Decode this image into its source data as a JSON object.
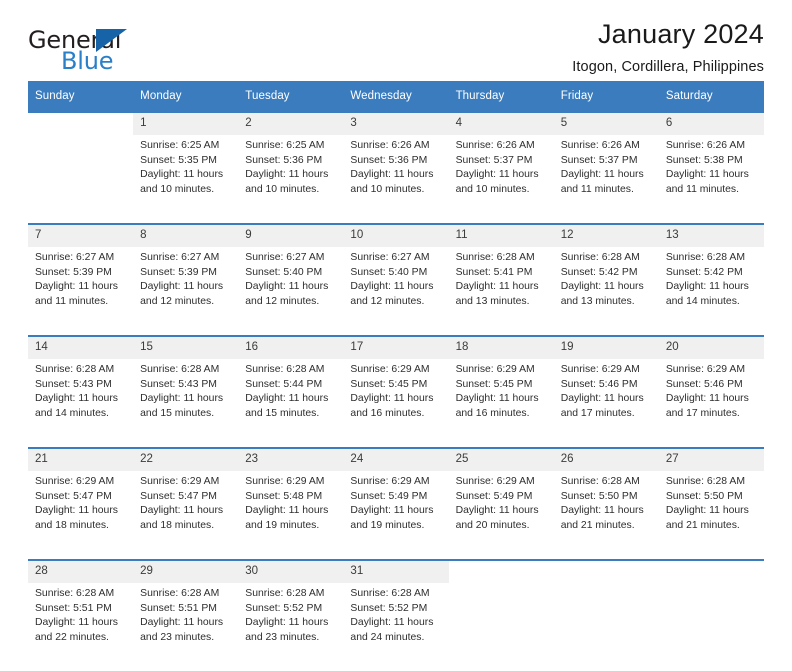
{
  "brand": {
    "name_top": "General",
    "name_bottom": "Blue",
    "accent_color": "#2a7fc9",
    "triangle_color": "#1763a8",
    "triangle_icon": "triangle-icon"
  },
  "header": {
    "title": "January 2024",
    "subtitle": "Itogon, Cordillera, Philippines"
  },
  "calendar": {
    "header_bg": "#3a7cbe",
    "daynum_bg": "#f0f0f0",
    "weekdays": [
      "Sunday",
      "Monday",
      "Tuesday",
      "Wednesday",
      "Thursday",
      "Friday",
      "Saturday"
    ],
    "weeks": [
      [
        {
          "day": "",
          "sunrise": "",
          "sunset": "",
          "daylight_1": "",
          "daylight_2": ""
        },
        {
          "day": "1",
          "sunrise": "Sunrise: 6:25 AM",
          "sunset": "Sunset: 5:35 PM",
          "daylight_1": "Daylight: 11 hours",
          "daylight_2": "and 10 minutes."
        },
        {
          "day": "2",
          "sunrise": "Sunrise: 6:25 AM",
          "sunset": "Sunset: 5:36 PM",
          "daylight_1": "Daylight: 11 hours",
          "daylight_2": "and 10 minutes."
        },
        {
          "day": "3",
          "sunrise": "Sunrise: 6:26 AM",
          "sunset": "Sunset: 5:36 PM",
          "daylight_1": "Daylight: 11 hours",
          "daylight_2": "and 10 minutes."
        },
        {
          "day": "4",
          "sunrise": "Sunrise: 6:26 AM",
          "sunset": "Sunset: 5:37 PM",
          "daylight_1": "Daylight: 11 hours",
          "daylight_2": "and 10 minutes."
        },
        {
          "day": "5",
          "sunrise": "Sunrise: 6:26 AM",
          "sunset": "Sunset: 5:37 PM",
          "daylight_1": "Daylight: 11 hours",
          "daylight_2": "and 11 minutes."
        },
        {
          "day": "6",
          "sunrise": "Sunrise: 6:26 AM",
          "sunset": "Sunset: 5:38 PM",
          "daylight_1": "Daylight: 11 hours",
          "daylight_2": "and 11 minutes."
        }
      ],
      [
        {
          "day": "7",
          "sunrise": "Sunrise: 6:27 AM",
          "sunset": "Sunset: 5:39 PM",
          "daylight_1": "Daylight: 11 hours",
          "daylight_2": "and 11 minutes."
        },
        {
          "day": "8",
          "sunrise": "Sunrise: 6:27 AM",
          "sunset": "Sunset: 5:39 PM",
          "daylight_1": "Daylight: 11 hours",
          "daylight_2": "and 12 minutes."
        },
        {
          "day": "9",
          "sunrise": "Sunrise: 6:27 AM",
          "sunset": "Sunset: 5:40 PM",
          "daylight_1": "Daylight: 11 hours",
          "daylight_2": "and 12 minutes."
        },
        {
          "day": "10",
          "sunrise": "Sunrise: 6:27 AM",
          "sunset": "Sunset: 5:40 PM",
          "daylight_1": "Daylight: 11 hours",
          "daylight_2": "and 12 minutes."
        },
        {
          "day": "11",
          "sunrise": "Sunrise: 6:28 AM",
          "sunset": "Sunset: 5:41 PM",
          "daylight_1": "Daylight: 11 hours",
          "daylight_2": "and 13 minutes."
        },
        {
          "day": "12",
          "sunrise": "Sunrise: 6:28 AM",
          "sunset": "Sunset: 5:42 PM",
          "daylight_1": "Daylight: 11 hours",
          "daylight_2": "and 13 minutes."
        },
        {
          "day": "13",
          "sunrise": "Sunrise: 6:28 AM",
          "sunset": "Sunset: 5:42 PM",
          "daylight_1": "Daylight: 11 hours",
          "daylight_2": "and 14 minutes."
        }
      ],
      [
        {
          "day": "14",
          "sunrise": "Sunrise: 6:28 AM",
          "sunset": "Sunset: 5:43 PM",
          "daylight_1": "Daylight: 11 hours",
          "daylight_2": "and 14 minutes."
        },
        {
          "day": "15",
          "sunrise": "Sunrise: 6:28 AM",
          "sunset": "Sunset: 5:43 PM",
          "daylight_1": "Daylight: 11 hours",
          "daylight_2": "and 15 minutes."
        },
        {
          "day": "16",
          "sunrise": "Sunrise: 6:28 AM",
          "sunset": "Sunset: 5:44 PM",
          "daylight_1": "Daylight: 11 hours",
          "daylight_2": "and 15 minutes."
        },
        {
          "day": "17",
          "sunrise": "Sunrise: 6:29 AM",
          "sunset": "Sunset: 5:45 PM",
          "daylight_1": "Daylight: 11 hours",
          "daylight_2": "and 16 minutes."
        },
        {
          "day": "18",
          "sunrise": "Sunrise: 6:29 AM",
          "sunset": "Sunset: 5:45 PM",
          "daylight_1": "Daylight: 11 hours",
          "daylight_2": "and 16 minutes."
        },
        {
          "day": "19",
          "sunrise": "Sunrise: 6:29 AM",
          "sunset": "Sunset: 5:46 PM",
          "daylight_1": "Daylight: 11 hours",
          "daylight_2": "and 17 minutes."
        },
        {
          "day": "20",
          "sunrise": "Sunrise: 6:29 AM",
          "sunset": "Sunset: 5:46 PM",
          "daylight_1": "Daylight: 11 hours",
          "daylight_2": "and 17 minutes."
        }
      ],
      [
        {
          "day": "21",
          "sunrise": "Sunrise: 6:29 AM",
          "sunset": "Sunset: 5:47 PM",
          "daylight_1": "Daylight: 11 hours",
          "daylight_2": "and 18 minutes."
        },
        {
          "day": "22",
          "sunrise": "Sunrise: 6:29 AM",
          "sunset": "Sunset: 5:47 PM",
          "daylight_1": "Daylight: 11 hours",
          "daylight_2": "and 18 minutes."
        },
        {
          "day": "23",
          "sunrise": "Sunrise: 6:29 AM",
          "sunset": "Sunset: 5:48 PM",
          "daylight_1": "Daylight: 11 hours",
          "daylight_2": "and 19 minutes."
        },
        {
          "day": "24",
          "sunrise": "Sunrise: 6:29 AM",
          "sunset": "Sunset: 5:49 PM",
          "daylight_1": "Daylight: 11 hours",
          "daylight_2": "and 19 minutes."
        },
        {
          "day": "25",
          "sunrise": "Sunrise: 6:29 AM",
          "sunset": "Sunset: 5:49 PM",
          "daylight_1": "Daylight: 11 hours",
          "daylight_2": "and 20 minutes."
        },
        {
          "day": "26",
          "sunrise": "Sunrise: 6:28 AM",
          "sunset": "Sunset: 5:50 PM",
          "daylight_1": "Daylight: 11 hours",
          "daylight_2": "and 21 minutes."
        },
        {
          "day": "27",
          "sunrise": "Sunrise: 6:28 AM",
          "sunset": "Sunset: 5:50 PM",
          "daylight_1": "Daylight: 11 hours",
          "daylight_2": "and 21 minutes."
        }
      ],
      [
        {
          "day": "28",
          "sunrise": "Sunrise: 6:28 AM",
          "sunset": "Sunset: 5:51 PM",
          "daylight_1": "Daylight: 11 hours",
          "daylight_2": "and 22 minutes."
        },
        {
          "day": "29",
          "sunrise": "Sunrise: 6:28 AM",
          "sunset": "Sunset: 5:51 PM",
          "daylight_1": "Daylight: 11 hours",
          "daylight_2": "and 23 minutes."
        },
        {
          "day": "30",
          "sunrise": "Sunrise: 6:28 AM",
          "sunset": "Sunset: 5:52 PM",
          "daylight_1": "Daylight: 11 hours",
          "daylight_2": "and 23 minutes."
        },
        {
          "day": "31",
          "sunrise": "Sunrise: 6:28 AM",
          "sunset": "Sunset: 5:52 PM",
          "daylight_1": "Daylight: 11 hours",
          "daylight_2": "and 24 minutes."
        },
        {
          "day": "",
          "sunrise": "",
          "sunset": "",
          "daylight_1": "",
          "daylight_2": ""
        },
        {
          "day": "",
          "sunrise": "",
          "sunset": "",
          "daylight_1": "",
          "daylight_2": ""
        },
        {
          "day": "",
          "sunrise": "",
          "sunset": "",
          "daylight_1": "",
          "daylight_2": ""
        }
      ]
    ]
  }
}
